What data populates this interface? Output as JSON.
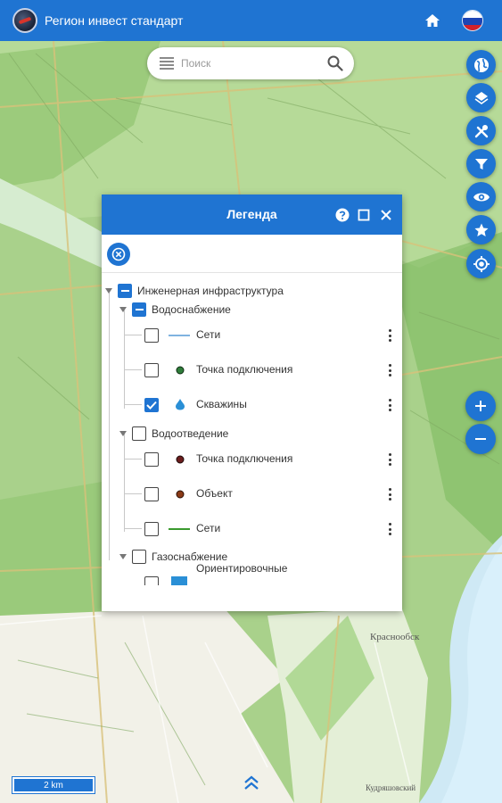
{
  "app": {
    "title": "Регион инвест стандарт"
  },
  "search": {
    "placeholder": "Поиск"
  },
  "right_toolbar": {
    "icons": [
      "globe-icon",
      "layers-icon",
      "tools-icon",
      "filter-icon",
      "eye-icon",
      "star-icon",
      "locate-icon"
    ]
  },
  "legend": {
    "title": "Легенда",
    "root": {
      "label": "Инженерная инфраструктура",
      "groups": [
        {
          "label": "Водоснабжение",
          "items": [
            {
              "label": "Сети",
              "symbol": "line",
              "color": "#7fb3e0",
              "checked": false
            },
            {
              "label": "Точка подключения",
              "symbol": "dot",
              "color": "#2f7d3a",
              "checked": false
            },
            {
              "label": "Скважины",
              "symbol": "drop",
              "color": "#2a8fd6",
              "checked": true
            }
          ]
        },
        {
          "label": "Водоотведение",
          "items": [
            {
              "label": "Точка подключения",
              "symbol": "dot",
              "color": "#6b1d1d",
              "checked": false
            },
            {
              "label": "Объект",
              "symbol": "dot",
              "color": "#8a3a17",
              "checked": false
            },
            {
              "label": "Сети",
              "symbol": "line",
              "color": "#3a9a2e",
              "checked": false
            }
          ]
        },
        {
          "label": "Газоснабжение",
          "items": [
            {
              "label": "Ориентировочные",
              "symbol": "square",
              "color": "#2a8fd6",
              "checked": false
            }
          ]
        }
      ]
    }
  },
  "map": {
    "scale_label": "2 km",
    "place_labels": [
      "Краснообск",
      "Кудряшовский"
    ]
  },
  "colors": {
    "brand": "#1f74d2",
    "map_green": "#9ccc7a"
  }
}
